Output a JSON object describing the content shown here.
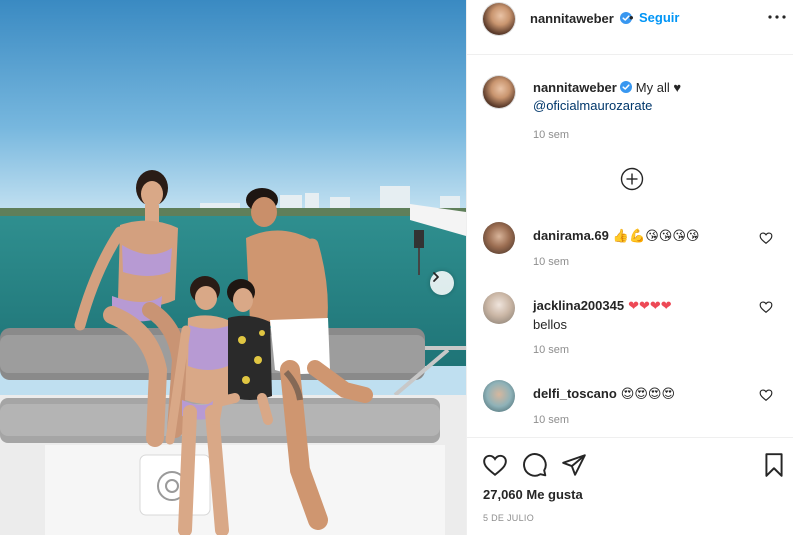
{
  "post": {
    "author": "nannitaweber",
    "follow_label": "Seguir",
    "separator": "•",
    "caption_text": "My all ♥",
    "caption_mention": "@oficialmaurozarate",
    "caption_time": "10 sem",
    "likes": "27,060 Me gusta",
    "date": "5 DE JULIO"
  },
  "comments": [
    {
      "username": "danirama.69",
      "text": "👍💪😘😘😘😘",
      "time": "10 sem"
    },
    {
      "username": "jacklina200345",
      "text": "❤❤❤❤",
      "text2": "bellos",
      "time": "10 sem"
    },
    {
      "username": "delfi_toscano",
      "text": "😍😍😍😍",
      "time": "10 sem"
    }
  ],
  "icons": {
    "verified": "verified-badge-icon",
    "more": "more-options-icon",
    "load_more": "plus-circle-icon",
    "comment_like": "heart-outline-icon",
    "like": "heart-outline-icon",
    "comment": "speech-bubble-icon",
    "share": "paper-plane-icon",
    "save": "bookmark-icon",
    "next": "chevron-right-icon"
  },
  "colors": {
    "accent": "#0095f6",
    "verified": "#3897f0",
    "text": "#262626",
    "muted": "#8e8e8e",
    "heart_red": "#ed4956"
  }
}
